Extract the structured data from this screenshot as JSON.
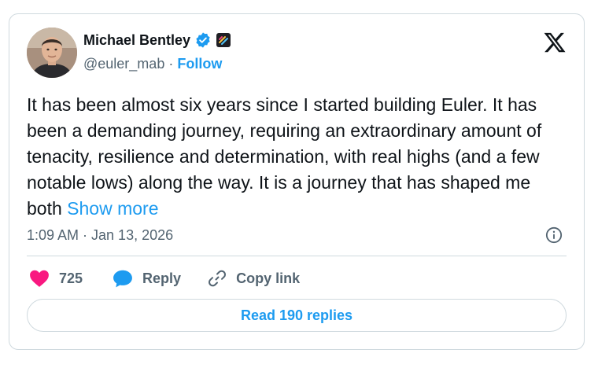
{
  "author": {
    "display_name": "Michael Bentley",
    "handle": "@euler_mab",
    "separator": "·",
    "follow_label": "Follow",
    "verified_icon": "verified-badge-icon",
    "affiliate_icon": "affiliate-badge-icon"
  },
  "tweet": {
    "text": "It has been almost six years since I started building Euler. It has been a demanding journey, requiring an extraordinary amount of tenacity, resilience and determination, with real highs (and a few notable lows) along the way. It is a journey that has shaped me both ",
    "show_more_label": "Show more",
    "timestamp": "1:09 AM · Jan 13, 2026"
  },
  "actions": {
    "like_count": "725",
    "reply_label": "Reply",
    "copy_link_label": "Copy link"
  },
  "read_replies_label": "Read 190 replies",
  "colors": {
    "accent": "#1d9bf0",
    "like": "#f91880",
    "text": "#0f1419",
    "muted": "#536471",
    "border": "#cfd9de"
  }
}
